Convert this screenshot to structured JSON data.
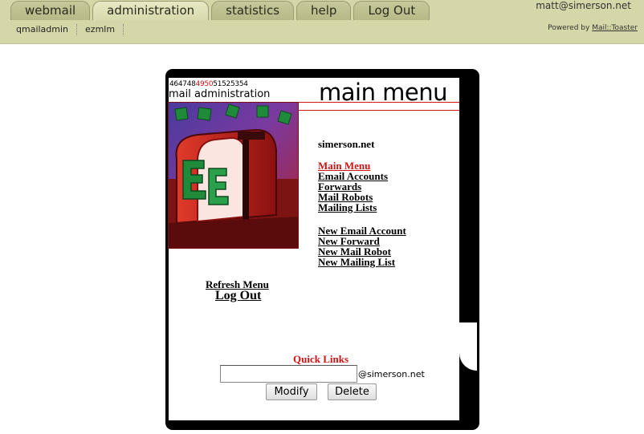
{
  "tabs": [
    {
      "label": "webmail"
    },
    {
      "label": "administration"
    },
    {
      "label": "statistics"
    },
    {
      "label": "help"
    },
    {
      "label": "Log Out"
    }
  ],
  "subnav": [
    {
      "label": "qmailadmin"
    },
    {
      "label": "ezmlm"
    }
  ],
  "user_email": "matt@simerson.net",
  "powered_by": {
    "prefix": "Powered by ",
    "link": "Mail::Toaster"
  },
  "panel": {
    "counter_prefix": "464748",
    "counter_highlight": "4950",
    "counter_suffix": "51525354",
    "subtitle": "mail administration",
    "title": "main menu",
    "domain": "simerson.net",
    "menu": [
      {
        "label": "Main Menu"
      },
      {
        "label": "Email Accounts"
      },
      {
        "label": "Forwards"
      },
      {
        "label": "Mail Robots"
      },
      {
        "label": "Mailing Lists"
      }
    ],
    "new_items": [
      {
        "label": "New Email Account"
      },
      {
        "label": "New Forward"
      },
      {
        "label": "New Mail Robot"
      },
      {
        "label": "New Mailing List"
      }
    ],
    "refresh_menu": "Refresh Menu",
    "log_out": "Log Out",
    "quick_links": {
      "title": "Quick Links",
      "input_value": "",
      "domain_suffix": "@simerson.net",
      "modify_label": "Modify",
      "delete_label": "Delete"
    }
  },
  "colors": {
    "header_bg": "#d6d7a8",
    "accent_red": "#d01414"
  }
}
